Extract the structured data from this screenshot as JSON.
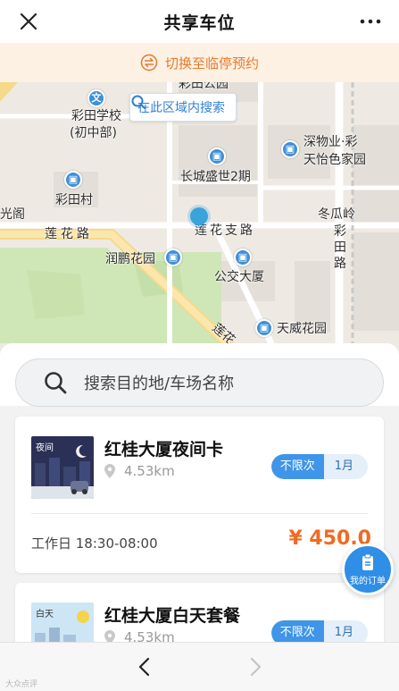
{
  "header": {
    "title": "共享车位",
    "close_icon": "close-icon",
    "more_icon": "more-dots-icon"
  },
  "banner": {
    "label": "切换至临停预约",
    "icon": "switch-icon"
  },
  "map": {
    "search_area_label": "在此区域内搜索",
    "labels": {
      "caitian_park": "彩田公园",
      "school": "彩田学校",
      "school_sub": "(初中部)",
      "changcheng": "长城盛世2期",
      "shenwuye_1": "深物业·彩",
      "shenwuye_2": "天怡色家园",
      "caitian_village": "彩田村",
      "guang_ge": "光阁",
      "dong_gua_ling": "冬瓜岭",
      "lianhua_road": "莲花路",
      "lianhua_branch": "莲花支路",
      "caitian_road": "彩田路",
      "runpeng": "润鹏花园",
      "bus_building": "公交大厦",
      "tianwei": "天威花园",
      "lianhua_diag": "莲花"
    }
  },
  "sheet": {
    "search_placeholder": "搜索目的地/车场名称",
    "cards": [
      {
        "thumb_label": "夜间",
        "title": "红桂大厦夜间卡",
        "distance": "4.53km",
        "tag_a": "不限次",
        "tag_b": "1月",
        "hours": "工作日 18:30-08:00",
        "price": "¥ 450.0"
      },
      {
        "thumb_label": "白天",
        "title": "红桂大厦白天套餐",
        "distance": "4.53km",
        "tag_a": "不限次",
        "tag_b": "1月"
      }
    ]
  },
  "orders_button": {
    "label": "我的订单"
  },
  "bottom_nav": {
    "back_icon": "chevron-left-icon",
    "forward_icon": "chevron-right-icon",
    "watermark": "大众点评"
  },
  "colors": {
    "accent": "#3f95e8",
    "price": "#f06a22",
    "banner_text": "#e8792e"
  }
}
